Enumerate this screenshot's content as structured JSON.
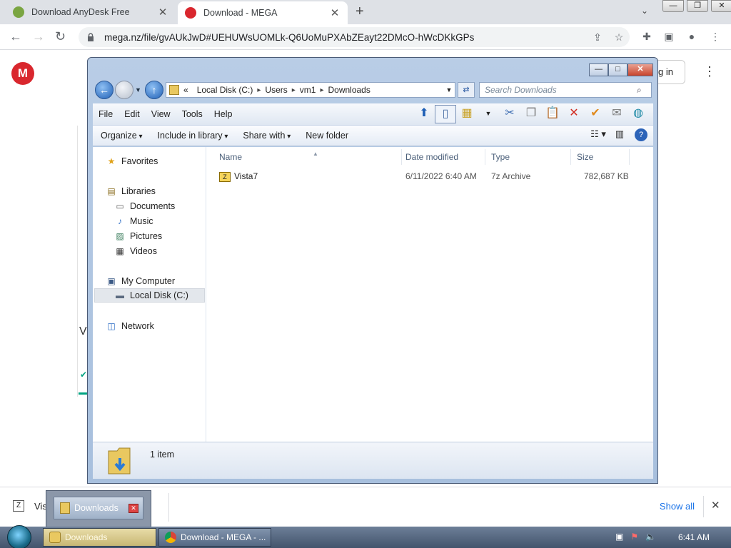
{
  "browser": {
    "tabs": [
      {
        "title": "Download AnyDesk Free",
        "active": false
      },
      {
        "title": "Download - MEGA",
        "active": true
      }
    ],
    "new_tab": "+",
    "url": "mega.nz/file/gvAUkJwD#UEHUWsUOMLk-Q6UoMuPXAbZEayt22DMcO-hWcDKkGPs",
    "page": {
      "logo_letter": "M",
      "login_label": "g in",
      "partial_title": "V"
    }
  },
  "explorer": {
    "breadcrumb": [
      "Local Disk (C:)",
      "Users",
      "vm1",
      "Downloads"
    ],
    "breadcrumb_prefix": "«",
    "search_placeholder": "Search Downloads",
    "menu": [
      "File",
      "Edit",
      "View",
      "Tools",
      "Help"
    ],
    "commands": [
      "Organize",
      "Include in library",
      "Share with",
      "New folder"
    ],
    "sidebar": {
      "favorites": "Favorites",
      "libraries": "Libraries",
      "library_items": [
        "Documents",
        "Music",
        "Pictures",
        "Videos"
      ],
      "my_computer": "My Computer",
      "local_disk": "Local Disk (C:)",
      "network": "Network"
    },
    "columns": [
      "Name",
      "Date modified",
      "Type",
      "Size"
    ],
    "files": [
      {
        "name": "Vista7",
        "date": "6/11/2022 6:40 AM",
        "type": "7z Archive",
        "size": "782,687 KB"
      }
    ],
    "status": "1 item"
  },
  "shelf": {
    "file_partial": "Vis",
    "show_all": "Show all",
    "thumbnail_label": "Downloads"
  },
  "taskbar": {
    "tasks": [
      "Downloads",
      "Download - MEGA - ..."
    ],
    "time": "6:41 AM"
  },
  "colors": {
    "mega_red": "#d9272e",
    "taskbar": "#4f627c",
    "link_blue": "#1a73e8"
  }
}
